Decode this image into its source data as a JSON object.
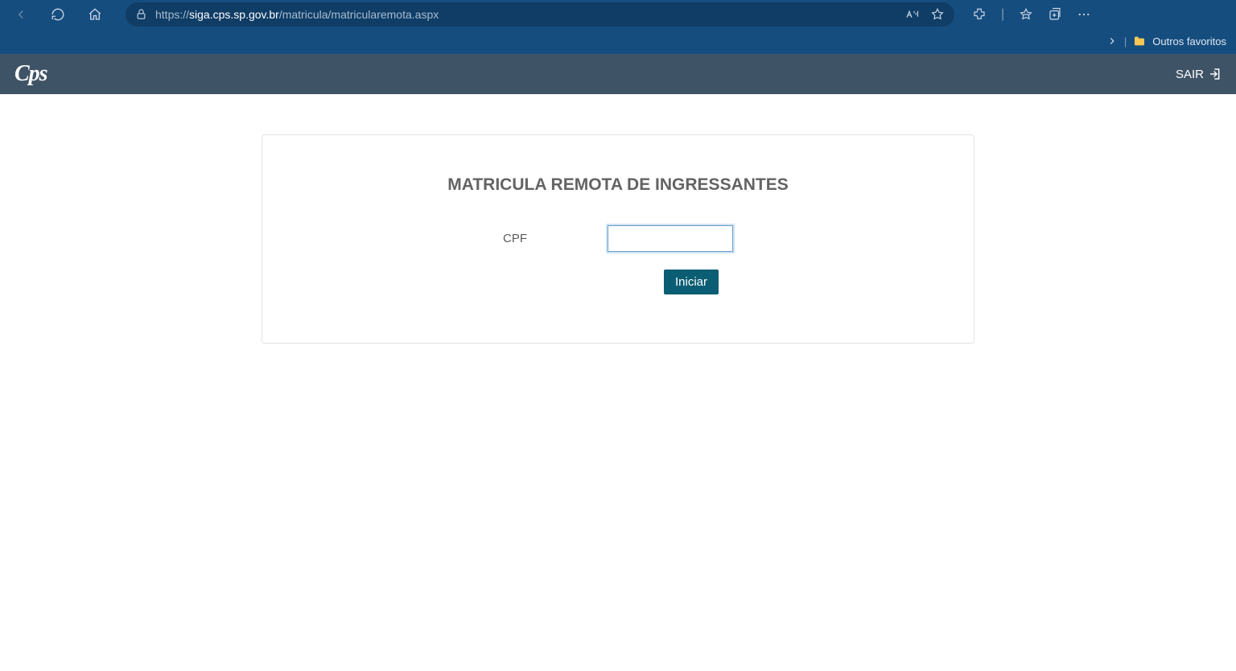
{
  "browser": {
    "url_prefix": "https://",
    "url_host": "siga.cps.sp.gov.br",
    "url_path": "/matricula/matricularemota.aspx",
    "favorites_label": "Outros favoritos"
  },
  "header": {
    "logo_text": "Cps",
    "logout_label": "SAIR"
  },
  "main": {
    "title": "MATRICULA REMOTA DE INGRESSANTES",
    "cpf_label": "CPF",
    "cpf_value": "",
    "submit_label": "Iniciar"
  }
}
